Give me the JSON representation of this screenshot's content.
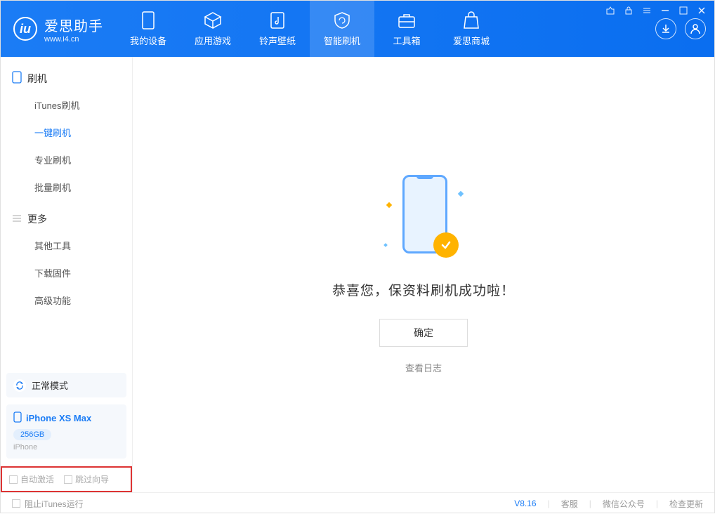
{
  "app": {
    "title": "爱思助手",
    "subtitle": "www.i4.cn"
  },
  "nav": {
    "device": "我的设备",
    "apps": "应用游戏",
    "ringtone": "铃声壁纸",
    "flash": "智能刷机",
    "toolbox": "工具箱",
    "store": "爱思商城"
  },
  "sidebar": {
    "flash": {
      "head": "刷机",
      "items": {
        "itunes": "iTunes刷机",
        "oneclick": "一键刷机",
        "pro": "专业刷机",
        "batch": "批量刷机"
      }
    },
    "more": {
      "head": "更多",
      "items": {
        "other": "其他工具",
        "firmware": "下载固件",
        "advanced": "高级功能"
      }
    }
  },
  "device": {
    "mode": "正常模式",
    "name": "iPhone XS Max",
    "storage": "256GB",
    "type": "iPhone"
  },
  "options": {
    "auto_activate": "自动激活",
    "skip_guide": "跳过向导"
  },
  "main": {
    "message": "恭喜您，保资料刷机成功啦！",
    "ok": "确定",
    "view_log": "查看日志"
  },
  "footer": {
    "block_itunes": "阻止iTunes运行",
    "version": "V8.16",
    "support": "客服",
    "wechat": "微信公众号",
    "update": "检查更新"
  }
}
